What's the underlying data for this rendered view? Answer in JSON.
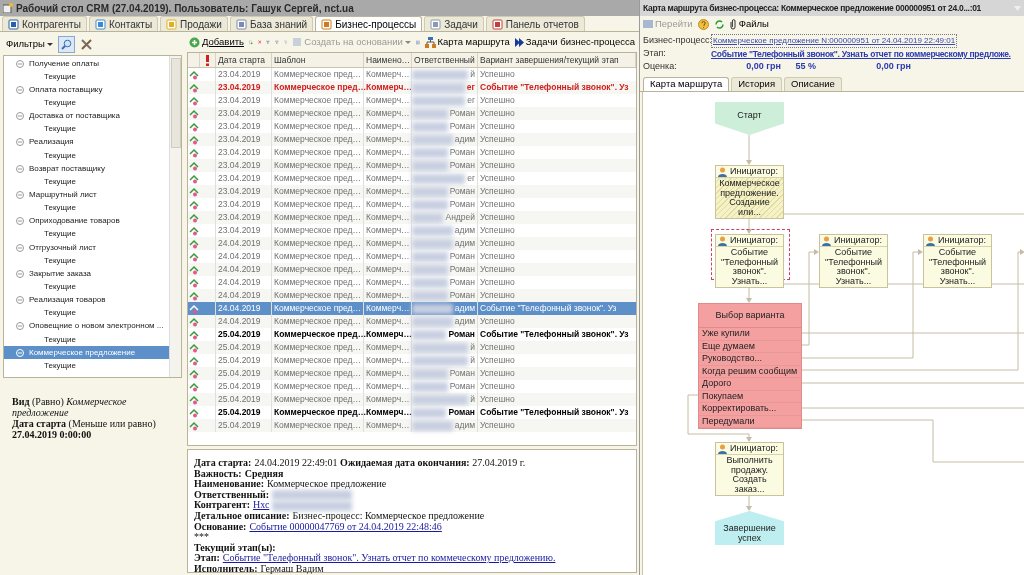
{
  "window": {
    "title": "Рабочий стол CRM (27.04.2019). Пользователь: Гашук Сергей, nct.ua"
  },
  "tabs": [
    {
      "label": "Контрагенты",
      "selected": false
    },
    {
      "label": "Контакты",
      "selected": false
    },
    {
      "label": "Продажи",
      "selected": false
    },
    {
      "label": "База знаний",
      "selected": false
    },
    {
      "label": "Бизнес-процессы",
      "selected": true
    },
    {
      "label": "Задачи",
      "selected": false
    },
    {
      "label": "Панель отчетов",
      "selected": false
    }
  ],
  "filters": {
    "label": "Фильтры"
  },
  "tree": [
    {
      "label": "Получение оплаты",
      "expanded": true,
      "selected": false,
      "children": [
        {
          "label": "Текущие",
          "selected": false
        }
      ]
    },
    {
      "label": "Оплата поставщику",
      "expanded": true,
      "selected": false,
      "children": [
        {
          "label": "Текущие",
          "selected": false
        }
      ]
    },
    {
      "label": "Доставка от поставщика",
      "expanded": true,
      "selected": false,
      "children": [
        {
          "label": "Текущие",
          "selected": false
        }
      ]
    },
    {
      "label": "Реализация",
      "expanded": true,
      "selected": false,
      "children": [
        {
          "label": "Текущие",
          "selected": false
        }
      ]
    },
    {
      "label": "Возврат поставщику",
      "expanded": true,
      "selected": false,
      "children": [
        {
          "label": "Текущие",
          "selected": false
        }
      ]
    },
    {
      "label": "Маршрутный лист",
      "expanded": true,
      "selected": false,
      "children": [
        {
          "label": "Текущие",
          "selected": false
        }
      ]
    },
    {
      "label": "Оприходование товаров",
      "expanded": true,
      "selected": false,
      "children": [
        {
          "label": "Текущие",
          "selected": false
        }
      ]
    },
    {
      "label": "Отгрузочный лист",
      "expanded": true,
      "selected": false,
      "children": [
        {
          "label": "Текущие",
          "selected": false
        }
      ]
    },
    {
      "label": "Закрытие заказа",
      "expanded": true,
      "selected": false,
      "children": [
        {
          "label": "Текущие",
          "selected": false
        }
      ]
    },
    {
      "label": "Реализация товаров",
      "expanded": true,
      "selected": false,
      "children": [
        {
          "label": "Текущие",
          "selected": false
        }
      ]
    },
    {
      "label": "Оповещние о новом электронном ...",
      "expanded": true,
      "selected": false,
      "children": [
        {
          "label": "Текущие",
          "selected": false
        }
      ]
    },
    {
      "label": "Коммерческое предложение",
      "expanded": true,
      "selected": true,
      "children": [
        {
          "label": "Текущие",
          "selected": false
        }
      ]
    }
  ],
  "filter_summary": [
    "**Вид** (Равно) *Коммерческое предложение*",
    "**Дата старта** (Меньше или равно) **27.04.2019 0:00:00**"
  ],
  "toolbar": {
    "add": "Добавить",
    "create_based_on": {
      "label": "Создать на основании",
      "disabled": true
    },
    "route_map": "Карта маршрута",
    "process_tasks": "Задачи бизнес-процесса"
  },
  "table": {
    "columns": [
      "Дата старта",
      "Шаблон",
      "Наимено…",
      "Ответственный",
      "Вариант завершения/текущий этап"
    ],
    "rows": [
      {
        "date": "23.04.2019",
        "template": "Коммерческое пред…",
        "name": "Коммерч…",
        "responsible": "й",
        "stage": "Успешно",
        "kind": "done",
        "selected": false
      },
      {
        "date": "23.04.2019",
        "template": "Коммерческое пред…",
        "name": "Коммерч…",
        "responsible": "ег",
        "stage": "Событие \"Телефонный звонок\". Уз",
        "kind": "overdue",
        "selected": false
      },
      {
        "date": "23.04.2019",
        "template": "Коммерческое пред…",
        "name": "Коммерч…",
        "responsible": "ег",
        "stage": "Успешно",
        "kind": "done",
        "selected": false
      },
      {
        "date": "23.04.2019",
        "template": "Коммерческое пред…",
        "name": "Коммерч…",
        "responsible": "Роман",
        "stage": "Успешно",
        "kind": "done",
        "selected": false
      },
      {
        "date": "23.04.2019",
        "template": "Коммерческое пред…",
        "name": "Коммерч…",
        "responsible": "Роман",
        "stage": "Успешно",
        "kind": "done",
        "selected": false
      },
      {
        "date": "23.04.2019",
        "template": "Коммерческое пред…",
        "name": "Коммерч…",
        "responsible": "адим",
        "stage": "Успешно",
        "kind": "done",
        "selected": false
      },
      {
        "date": "23.04.2019",
        "template": "Коммерческое пред…",
        "name": "Коммерч…",
        "responsible": "Роман",
        "stage": "Успешно",
        "kind": "done",
        "selected": false
      },
      {
        "date": "23.04.2019",
        "template": "Коммерческое пред…",
        "name": "Коммерч…",
        "responsible": "Роман",
        "stage": "Успешно",
        "kind": "done",
        "selected": false
      },
      {
        "date": "23.04.2019",
        "template": "Коммерческое пред…",
        "name": "Коммерч…",
        "responsible": "ег",
        "stage": "Успешно",
        "kind": "done",
        "selected": false
      },
      {
        "date": "23.04.2019",
        "template": "Коммерческое пред…",
        "name": "Коммерч…",
        "responsible": "Роман",
        "stage": "Успешно",
        "kind": "done",
        "selected": false
      },
      {
        "date": "23.04.2019",
        "template": "Коммерческое пред…",
        "name": "Коммерч…",
        "responsible": "Роман",
        "stage": "Успешно",
        "kind": "done",
        "selected": false
      },
      {
        "date": "23.04.2019",
        "template": "Коммерческое пред…",
        "name": "Коммерч…",
        "responsible": "Андрей",
        "stage": "Успешно",
        "kind": "done",
        "selected": false
      },
      {
        "date": "23.04.2019",
        "template": "Коммерческое пред…",
        "name": "Коммерч…",
        "responsible": "адим",
        "stage": "Успешно",
        "kind": "done",
        "selected": false
      },
      {
        "date": "24.04.2019",
        "template": "Коммерческое пред…",
        "name": "Коммерч…",
        "responsible": "адим",
        "stage": "Успешно",
        "kind": "done",
        "selected": false
      },
      {
        "date": "24.04.2019",
        "template": "Коммерческое пред…",
        "name": "Коммерч…",
        "responsible": "Роман",
        "stage": "Успешно",
        "kind": "done",
        "selected": false
      },
      {
        "date": "24.04.2019",
        "template": "Коммерческое пред…",
        "name": "Коммерч…",
        "responsible": "Роман",
        "stage": "Успешно",
        "kind": "done",
        "selected": false
      },
      {
        "date": "24.04.2019",
        "template": "Коммерческое пред…",
        "name": "Коммерч…",
        "responsible": "Роман",
        "stage": "Успешно",
        "kind": "done",
        "selected": false
      },
      {
        "date": "24.04.2019",
        "template": "Коммерческое пред…",
        "name": "Коммерч…",
        "responsible": "Роман",
        "stage": "Успешно",
        "kind": "done",
        "selected": false
      },
      {
        "date": "24.04.2019",
        "template": "Коммерческое пред…",
        "name": "Коммерч…",
        "responsible": "адим",
        "stage": "Событие \"Телефонный звонок\". Уз",
        "kind": "open",
        "selected": true
      },
      {
        "date": "24.04.2019",
        "template": "Коммерческое пред…",
        "name": "Коммерч…",
        "responsible": "адим",
        "stage": "Успешно",
        "kind": "done",
        "selected": false
      },
      {
        "date": "25.04.2019",
        "template": "Коммерческое пред…",
        "name": "Коммерч…",
        "responsible": "Роман",
        "stage": "Событие \"Телефонный звонок\". Уз",
        "kind": "active",
        "selected": false
      },
      {
        "date": "25.04.2019",
        "template": "Коммерческое пред…",
        "name": "Коммерч…",
        "responsible": "й",
        "stage": "Успешно",
        "kind": "done",
        "selected": false
      },
      {
        "date": "25.04.2019",
        "template": "Коммерческое пред…",
        "name": "Коммерч…",
        "responsible": "й",
        "stage": "Успешно",
        "kind": "done",
        "selected": false
      },
      {
        "date": "25.04.2019",
        "template": "Коммерческое пред…",
        "name": "Коммерч…",
        "responsible": "Роман",
        "stage": "Успешно",
        "kind": "done",
        "selected": false
      },
      {
        "date": "25.04.2019",
        "template": "Коммерческое пред…",
        "name": "Коммерч…",
        "responsible": "Роман",
        "stage": "Успешно",
        "kind": "done",
        "selected": false
      },
      {
        "date": "25.04.2019",
        "template": "Коммерческое пред…",
        "name": "Коммерч…",
        "responsible": "й",
        "stage": "Успешно",
        "kind": "done",
        "selected": false
      },
      {
        "date": "25.04.2019",
        "template": "Коммерческое пред…",
        "name": "Коммерч…",
        "responsible": "Роман",
        "stage": "Событие \"Телефонный звонок\". Уз",
        "kind": "active",
        "selected": false
      },
      {
        "date": "25.04.2019",
        "template": "Коммерческое пред…",
        "name": "Коммерч…",
        "responsible": "адим",
        "stage": "Успешно",
        "kind": "done",
        "selected": false
      }
    ]
  },
  "details": [
    {
      "label": "Дата старта:",
      "value": "24.04.2019 22:49:01 **Ожидаемая дата окончания:** 27.04.2019 г."
    },
    {
      "label": "Важность:",
      "value": "**Средняя**"
    },
    {
      "label": "Наименование:",
      "value": "Коммерческое предложение"
    },
    {
      "label": "Ответственный:",
      "redacted": true
    },
    {
      "label": "Контрагент:",
      "link": "Нхс",
      "redacted": true
    },
    {
      "label": "Детальное описание:",
      "value": "Бизнес-процесс: Коммерческое предложение"
    },
    {
      "label": "Основание:",
      "link": "Событие 00000047769 от 24.04.2019 22:48:46"
    },
    {
      "value": "***"
    },
    {
      "label": "Текущий этап(ы):"
    },
    {
      "label": "Этап:",
      "link": "Событие \"Телефонный звонок\". Узнать отчет по коммеческому предложению."
    },
    {
      "label": "Исполнитель:",
      "value": "Гермаш Вадим"
    }
  ],
  "route_window": {
    "title": "Карта маршрута бизнес-процесса: Коммерческое предложение 000000951 от 24.0...:01",
    "toolbar": {
      "go": {
        "label": "Перейти",
        "disabled": true
      },
      "files": "Файлы"
    },
    "process": {
      "label": "Бизнес-процесс:",
      "link": "Коммерческое предложение N:000000951 от 24.04.2019 22:49:01"
    },
    "stage": {
      "label": "Этап:",
      "link": "Событие \"Телефонный звонок\". Узнать отчет по коммерческому предложе."
    },
    "estimate": {
      "label": "Оценка:",
      "amount": "0,00 грн",
      "percent": "55 %",
      "total": "0,00 грн"
    },
    "tabs": [
      {
        "label": "Карта маршрута",
        "selected": true
      },
      {
        "label": "История",
        "selected": false
      },
      {
        "label": "Описание",
        "selected": false
      }
    ],
    "diagram": {
      "start": "Старт",
      "tasks": [
        {
          "role": "Инициатор:",
          "text": "Коммерческое предложение. Создание или...",
          "kind": "done"
        },
        {
          "role": "Инициатор:",
          "text": "Событие \"Телефонный звонок\". Узнать...",
          "kind": "current"
        },
        {
          "role": "Инициатор:",
          "text": "Событие \"Телефонный звонок\". Узнать...",
          "kind": "pending"
        },
        {
          "role": "Инициатор:",
          "text": "Событие \"Телефонный звонок\". Узнать...",
          "kind": "pending"
        },
        {
          "role": "Инициатор:",
          "text": "Выполнить продажу. Создать заказ...",
          "kind": "pending"
        }
      ],
      "choice": {
        "title": "Выбор варианта",
        "options": [
          "Уже купили",
          "Еще думаем",
          "Руководство...",
          "Когда решим сообщим",
          "Дорого",
          "Покупаем",
          "Корректировать...",
          "Передумали"
        ]
      },
      "end": "Завершение успех"
    }
  }
}
